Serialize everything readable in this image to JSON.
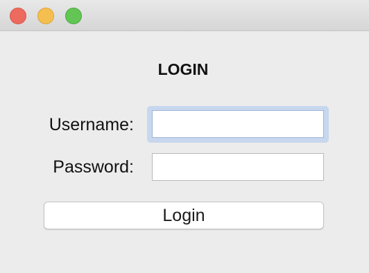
{
  "window": {
    "controls": {
      "close": {
        "icon": "close-traffic-light-icon",
        "color": "#ed6a5e"
      },
      "minimize": {
        "icon": "minimize-traffic-light-icon",
        "color": "#f5bf4f"
      },
      "maximize": {
        "icon": "maximize-traffic-light-icon",
        "color": "#62c554"
      }
    }
  },
  "form": {
    "heading": "LOGIN",
    "username_label": "Username:",
    "username_value": "",
    "password_label": "Password:",
    "password_value": "",
    "submit_label": "Login",
    "focus_ring_color": "#c7d7ee"
  }
}
